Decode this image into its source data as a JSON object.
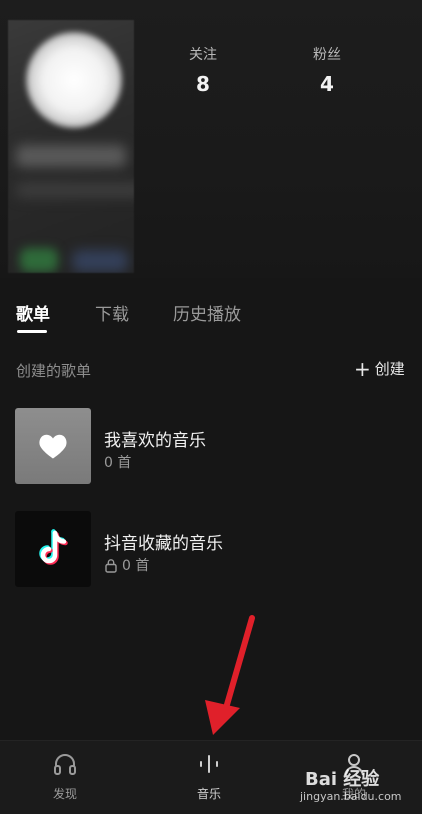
{
  "profile": {
    "following_label": "关注",
    "following_count": "8",
    "followers_label": "粉丝",
    "followers_count": "4"
  },
  "tabs": [
    {
      "label": "歌单",
      "active": true
    },
    {
      "label": "下载",
      "active": false
    },
    {
      "label": "历史播放",
      "active": false
    }
  ],
  "section": {
    "title": "创建的歌单",
    "create_label": "创建"
  },
  "playlists": [
    {
      "title": "我喜欢的音乐",
      "count": "0 首",
      "icon": "heart-icon",
      "locked": false
    },
    {
      "title": "抖音收藏的音乐",
      "count": "0 首",
      "icon": "tiktok-logo-icon",
      "locked": true
    }
  ],
  "bottom_nav": [
    {
      "label": "发现",
      "icon": "headphones-icon",
      "active": false
    },
    {
      "label": "音乐",
      "icon": "music-bars-icon",
      "active": true
    },
    {
      "label": "我的",
      "icon": "profile-icon",
      "active": false
    }
  ],
  "watermark": {
    "text": "Bai 经验",
    "url": "jingyan.baidu.com"
  },
  "colors": {
    "background": "#161616",
    "annotation_arrow": "#e0202a"
  }
}
